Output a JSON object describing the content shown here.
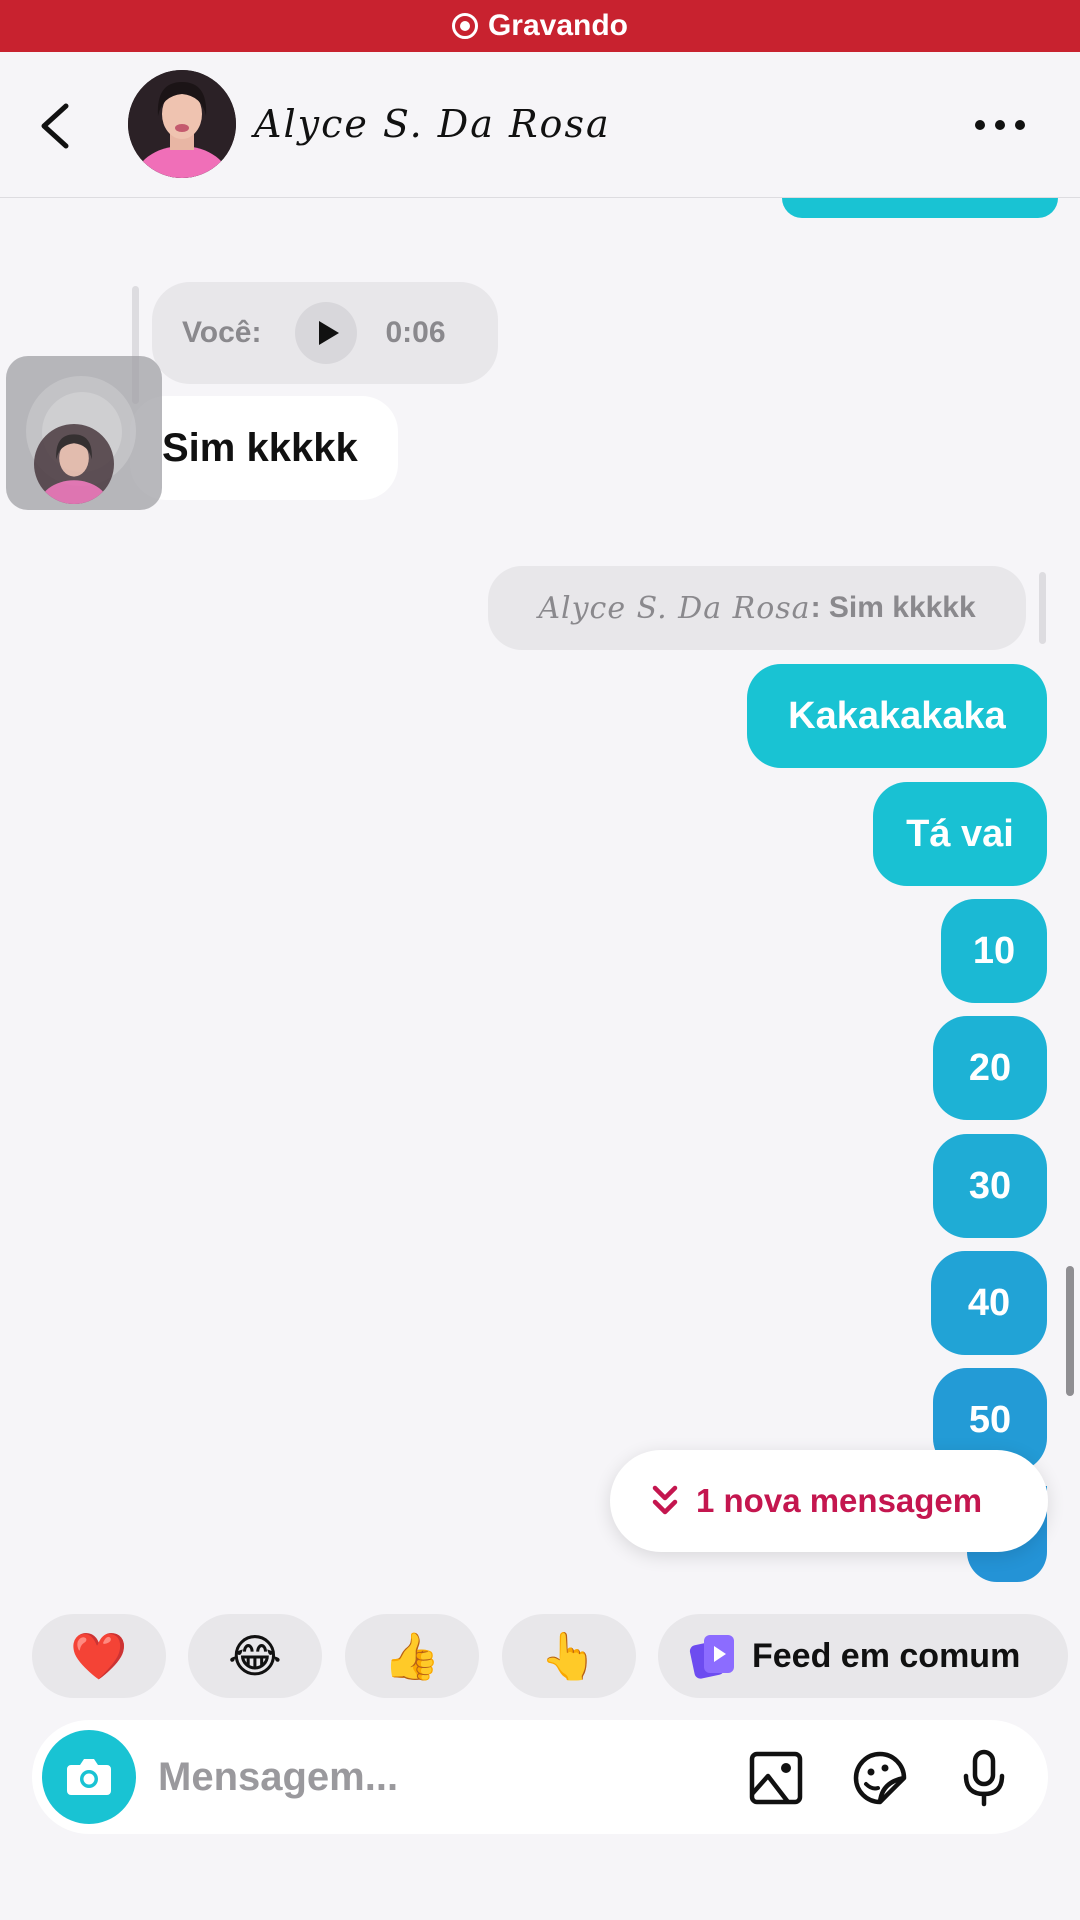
{
  "recording": {
    "label": "Gravando"
  },
  "header": {
    "contact_name": "Alyce S. Da Rosa"
  },
  "messages": {
    "voice": {
      "sender": "Você:",
      "duration": "0:06"
    },
    "received": {
      "text": "Sim kkkkk"
    },
    "quote": {
      "name": "Alyce S. Da Rosa",
      "text": ": Sim kkkkk"
    },
    "sent": [
      "Kakakakaka",
      "Tá vai",
      "10",
      "20",
      "30",
      "40",
      "50"
    ]
  },
  "new_message_pill": {
    "label": "1 nova mensagem"
  },
  "quick_reactions": {
    "items": [
      "❤️",
      "😂",
      "👍",
      "👆"
    ],
    "feed_label": "Feed em comum"
  },
  "composer": {
    "placeholder": "Mensagem..."
  },
  "colors": {
    "recording_bar": "#c8222f",
    "sent_bubble_top": "#19c3d3",
    "sent_bubble_bottom": "#2493d6",
    "new_message_text": "#c4164f",
    "camera_button": "#19c3d3"
  }
}
